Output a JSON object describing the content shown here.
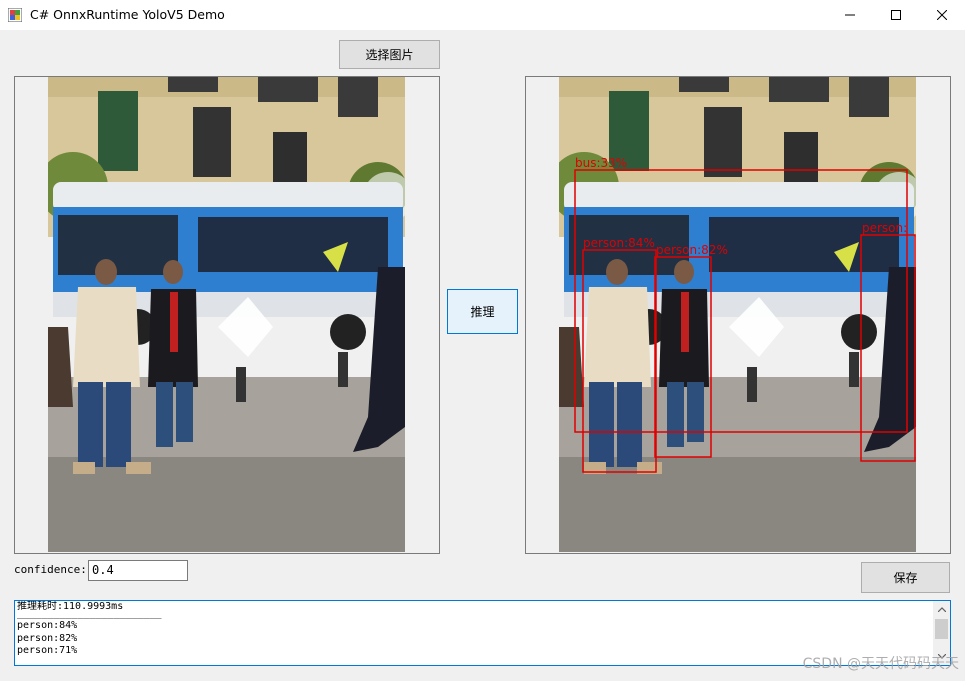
{
  "window": {
    "title": "C# OnnxRuntime YoloV5 Demo"
  },
  "buttons": {
    "select_image": "选择图片",
    "infer": "推理",
    "save": "保存"
  },
  "confidence": {
    "label": "confidence:",
    "value": "0.4"
  },
  "log": {
    "lines": [
      "推理耗时:110.9993ms",
      "________________________",
      "",
      "person:84%",
      "person:82%",
      "person:71%"
    ]
  },
  "detections": [
    {
      "label": "bus:33%"
    },
    {
      "label": "person:84%"
    },
    {
      "label": "person:82%"
    },
    {
      "label": "person:"
    }
  ],
  "watermark": "CSDN @天天代码码天天",
  "colors": {
    "box": "#e00000",
    "focus": "#0078d7",
    "bus_blue": "#2f7fd0"
  }
}
